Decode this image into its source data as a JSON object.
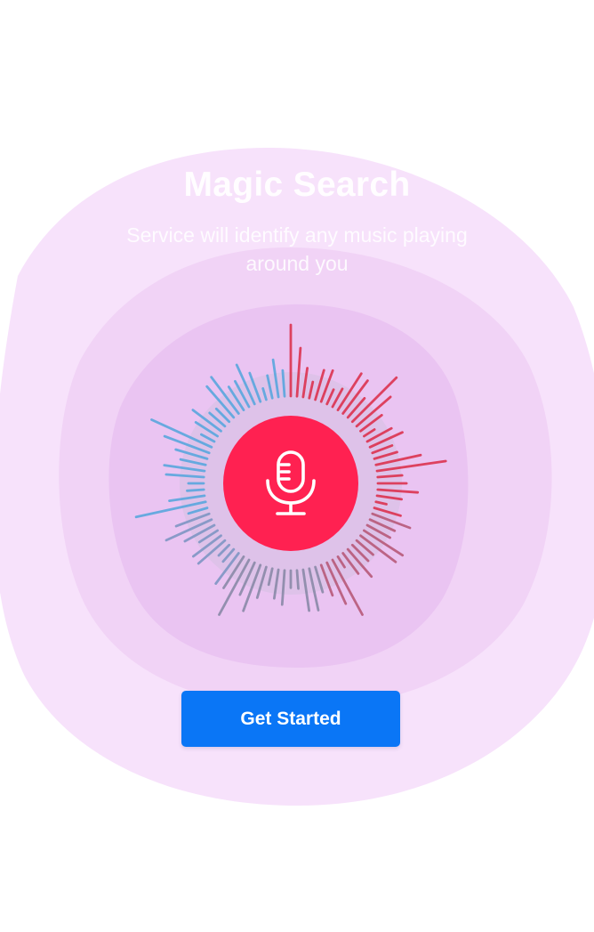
{
  "screen": {
    "title": "Magic Search",
    "subtitle": "Service will identify any music playing around you",
    "cta_label": "Get Started"
  },
  "icons": {
    "mic": "microphone-icon"
  },
  "colors": {
    "background": "#ffffff",
    "blob_outer": "#f7e2fb",
    "blob_middle": "#f2d2f7",
    "blob_inner": "#ebc4f2",
    "mic_button": "#ff2151",
    "bar_blue": "#5aa7de",
    "bar_red": "#dc3350",
    "bar_gray": "#8a8aa8",
    "cta_background": "#0a76f6",
    "cta_text": "#ffffff"
  }
}
